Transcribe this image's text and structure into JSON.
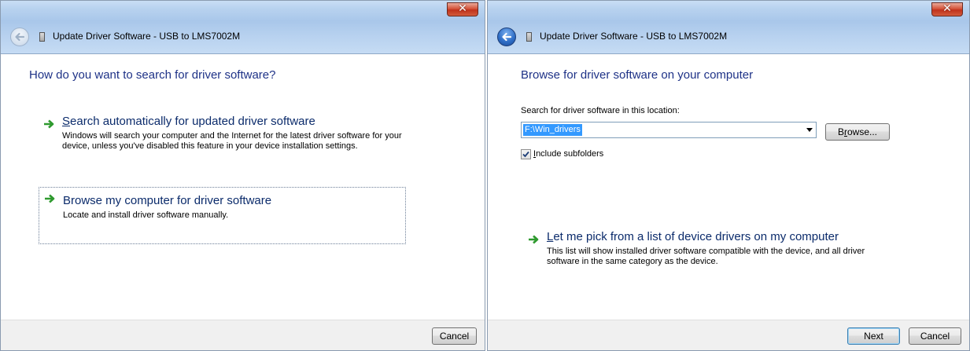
{
  "left_window": {
    "title": "Update Driver Software - USB to LMS7002M",
    "close_label": "✕",
    "heading": "How do you want to search for driver software?",
    "option_auto": {
      "title_accel": "S",
      "title_rest": "earch automatically for updated driver software",
      "desc": "Windows will search your computer and the Internet for the latest driver software for your device, unless you've disabled this feature in your device installation settings."
    },
    "option_browse": {
      "title": "Browse my computer for driver software",
      "desc": "Locate and install driver software manually."
    },
    "cancel_label": "Cancel"
  },
  "right_window": {
    "title": "Update Driver Software - USB to LMS7002M",
    "close_label": "✕",
    "heading": "Browse for driver software on your computer",
    "search_label": "Search for driver software in this location:",
    "path_value": "F:\\Win_drivers",
    "browse_accel": "r",
    "browse_pre": "B",
    "browse_post": "owse...",
    "include_accel": "I",
    "include_rest": "nclude subfolders",
    "include_checked": true,
    "option_pick": {
      "title_accel": "L",
      "title_rest": "et me pick from a list of device drivers on my computer",
      "desc": "This list will show installed driver software compatible with the device, and all driver software in the same category as the device."
    },
    "next_label": "Next",
    "cancel_label": "Cancel"
  },
  "colors": {
    "heading": "#1e3287",
    "arrow_green": "#2f9a2f",
    "selection": "#3399ff"
  }
}
